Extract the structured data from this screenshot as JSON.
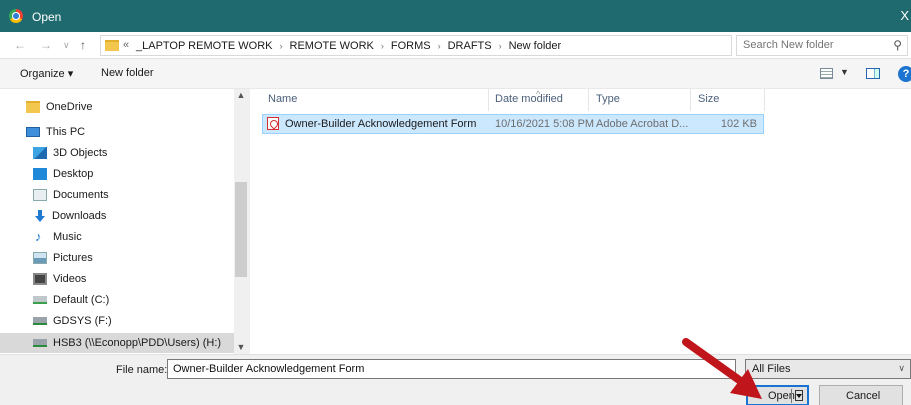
{
  "window": {
    "title": "Open",
    "close_glyph": "X"
  },
  "addressbar": {
    "prefix": "«",
    "crumbs": [
      "_LAPTOP REMOTE WORK",
      "REMOTE WORK",
      "FORMS",
      "DRAFTS",
      "New folder"
    ],
    "search_placeholder": "Search New folder"
  },
  "toolbar": {
    "organize": "Organize ▾",
    "new_folder": "New folder",
    "help": "?"
  },
  "navpane": {
    "items": [
      {
        "label": "OneDrive",
        "icon": "folder-icon"
      },
      {
        "label": "This PC",
        "icon": "pc-icon"
      },
      {
        "label": "3D Objects",
        "icon": "3d-objects-icon"
      },
      {
        "label": "Desktop",
        "icon": "desktop-icon"
      },
      {
        "label": "Documents",
        "icon": "documents-icon"
      },
      {
        "label": "Downloads",
        "icon": "downloads-icon"
      },
      {
        "label": "Music",
        "icon": "music-icon"
      },
      {
        "label": "Pictures",
        "icon": "pictures-icon"
      },
      {
        "label": "Videos",
        "icon": "videos-icon"
      },
      {
        "label": "Default (C:)",
        "icon": "drive-icon"
      },
      {
        "label": "GDSYS (F:)",
        "icon": "network-drive-icon"
      },
      {
        "label": "HSB3 (\\\\Econopp\\PDD\\Users) (H:)",
        "icon": "network-drive-icon",
        "selected": true
      }
    ]
  },
  "filelist": {
    "columns": [
      "Name",
      "Date modified",
      "Type",
      "Size"
    ],
    "rows": [
      {
        "name": "Owner-Builder Acknowledgement Form",
        "date": "10/16/2021 5:08 PM",
        "type": "Adobe Acrobat D...",
        "size": "102 KB"
      }
    ]
  },
  "footer": {
    "filename_label": "File name:",
    "filename_value": "Owner-Builder Acknowledgement Form",
    "filter": "All Files",
    "open_label": "Open",
    "cancel_label": "Cancel"
  },
  "colors": {
    "titlebar": "#1f6a6e",
    "selection": "#cce8ff",
    "arrow": "#c0161b"
  }
}
